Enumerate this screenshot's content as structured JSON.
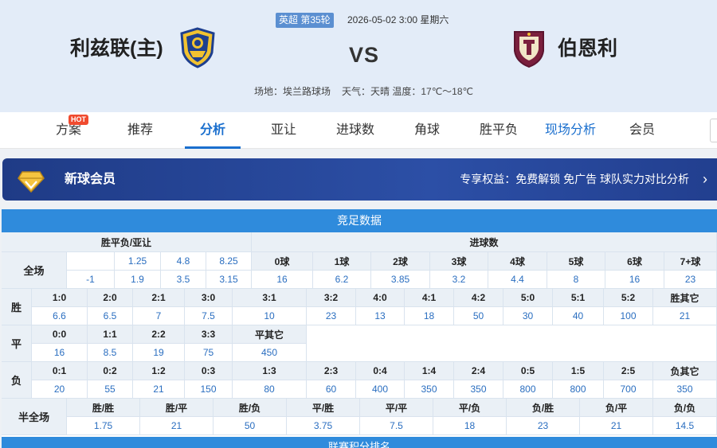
{
  "match": {
    "league_round": "英超 第35轮",
    "datetime": "2026-05-02 3:00 星期六",
    "home_team": "利兹联(主)",
    "away_team": "伯恩利",
    "vs": "VS",
    "venue": "场地：埃兰路球场",
    "weather": "天气：天晴 温度：17℃～18℃"
  },
  "tabs": {
    "items": [
      "方案",
      "推荐",
      "分析",
      "亚让",
      "进球数",
      "角球",
      "胜平负",
      "现场分析",
      "会员"
    ],
    "active": "分析",
    "hot_badge": "HOT"
  },
  "member": {
    "title": "新球会员",
    "benefit": "专享权益：免费解锁 免广告 球队实力对比分析"
  },
  "odds": {
    "title": "竞足数据",
    "wdl_header": "胜平负/亚让",
    "goals_header": "进球数",
    "full_label": "全场",
    "handicap": [
      "",
      "-1"
    ],
    "wdl_row1": [
      "1.25",
      "4.8",
      "8.25"
    ],
    "wdl_row2": [
      "1.9",
      "3.5",
      "3.15"
    ],
    "goals_labels": [
      "0球",
      "1球",
      "2球",
      "3球",
      "4球",
      "5球",
      "6球",
      "7+球"
    ],
    "goals_values": [
      "16",
      "6.2",
      "3.85",
      "3.2",
      "4.4",
      "8",
      "16",
      "23"
    ],
    "win_label": "胜",
    "win_scores": [
      "1:0",
      "2:0",
      "2:1",
      "3:0",
      "3:1",
      "3:2",
      "4:0",
      "4:1",
      "4:2",
      "5:0",
      "5:1",
      "5:2",
      "胜其它"
    ],
    "win_odds": [
      "6.6",
      "6.5",
      "7",
      "7.5",
      "10",
      "23",
      "13",
      "18",
      "50",
      "30",
      "40",
      "100",
      "21"
    ],
    "draw_label": "平",
    "draw_scores": [
      "0:0",
      "1:1",
      "2:2",
      "3:3",
      "平其它"
    ],
    "draw_odds": [
      "16",
      "8.5",
      "19",
      "75",
      "450"
    ],
    "loss_label": "负",
    "loss_scores": [
      "0:1",
      "0:2",
      "1:2",
      "0:3",
      "1:3",
      "2:3",
      "0:4",
      "1:4",
      "2:4",
      "0:5",
      "1:5",
      "2:5",
      "负其它"
    ],
    "loss_odds": [
      "20",
      "55",
      "21",
      "150",
      "80",
      "60",
      "400",
      "350",
      "350",
      "800",
      "800",
      "700",
      "350"
    ],
    "half_full_label": "半全场",
    "half_full_labels": [
      "胜/胜",
      "胜/平",
      "胜/负",
      "平/胜",
      "平/平",
      "平/负",
      "负/胜",
      "负/平",
      "负/负"
    ],
    "half_full_values": [
      "1.75",
      "21",
      "50",
      "3.75",
      "7.5",
      "18",
      "23",
      "21",
      "14.5"
    ],
    "next_section": "联赛积分排名"
  },
  "colors": {
    "accent": "#1a6fce",
    "odds_blue": "#2a6ec0",
    "header_bg": "#e3ecf8",
    "member_bg": "#223f8f",
    "hot": "#f04b2f"
  }
}
